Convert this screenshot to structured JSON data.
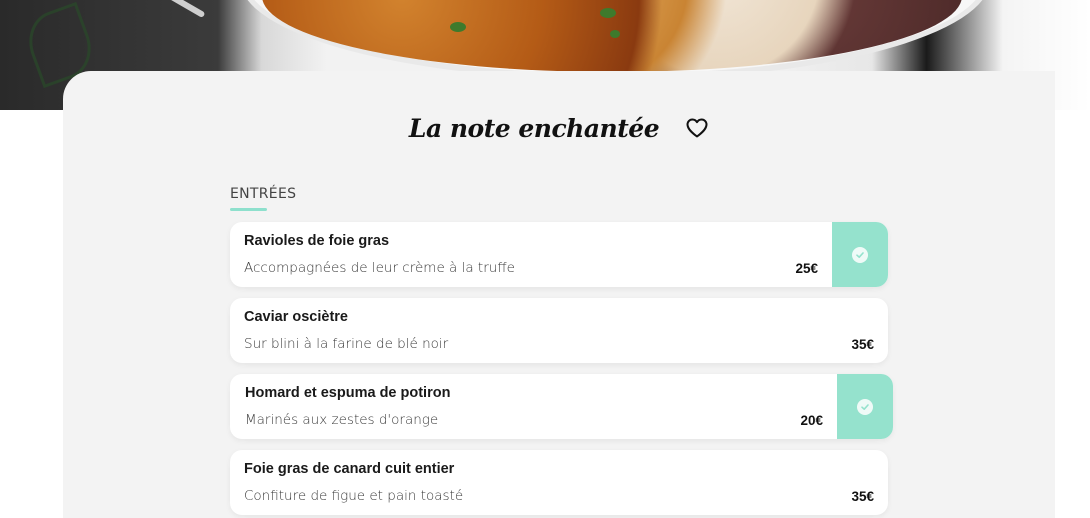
{
  "restaurant": {
    "name": "La note enchantée",
    "favorite_icon": "heart-outline-icon"
  },
  "menu": {
    "section_label": "ENTRÉES",
    "accent_color": "#95e2cd",
    "items": [
      {
        "name": "Ravioles de foie gras",
        "description": "Accompagnées de leur crème à la truffe",
        "price": "25€",
        "selected": true
      },
      {
        "name": "Caviar osciètre",
        "description": "Sur blini à la farine de blé noir",
        "price": "35€",
        "selected": false
      },
      {
        "name": "Homard et espuma de potiron",
        "description": "Marinés aux zestes d'orange",
        "price": "20€",
        "selected": true
      },
      {
        "name": "Foie gras de canard cuit entier",
        "description": "Confiture de figue et pain toasté",
        "price": "35€",
        "selected": false
      }
    ]
  }
}
